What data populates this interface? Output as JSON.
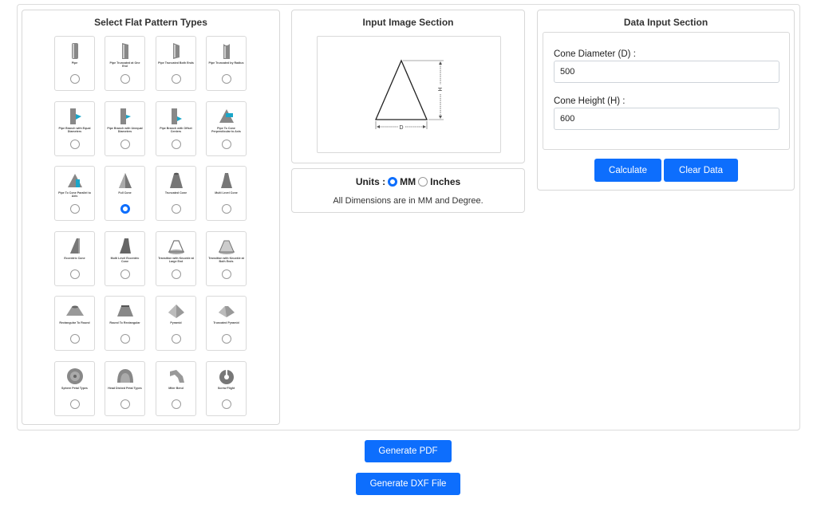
{
  "types_panel": {
    "title": "Select Flat Pattern Types",
    "items": [
      {
        "label": "Pipe",
        "icon": "pipe-icon",
        "selected": false
      },
      {
        "label": "Pipe Truncated at One End",
        "icon": "pipe-truncated-icon",
        "selected": false
      },
      {
        "label": "Pipe Truncated Both Ends",
        "icon": "pipe-truncated-both-icon",
        "selected": false
      },
      {
        "label": "Pipe Truncated by Radius",
        "icon": "pipe-radius-icon",
        "selected": false
      },
      {
        "label": "Pipe Branch with Equal Diameters",
        "icon": "pipe-branch-equal-icon",
        "selected": false
      },
      {
        "label": "Pipe Branch with Unequal Diameters",
        "icon": "pipe-branch-unequal-icon",
        "selected": false
      },
      {
        "label": "Pipe Branch with Offset Centers",
        "icon": "pipe-branch-offset-icon",
        "selected": false
      },
      {
        "label": "Pipe To Cone Perpendicular to Axis",
        "icon": "pipe-to-cone-perp-icon",
        "selected": false
      },
      {
        "label": "Pipe To Cone Parallel to Axis",
        "icon": "pipe-to-cone-parallel-icon",
        "selected": false
      },
      {
        "label": "Full Cone",
        "icon": "full-cone-icon",
        "selected": true
      },
      {
        "label": "Truncated Cone",
        "icon": "truncated-cone-icon",
        "selected": false
      },
      {
        "label": "Multi Level Cone",
        "icon": "multi-level-cone-icon",
        "selected": false
      },
      {
        "label": "Eccentric Cone",
        "icon": "eccentric-cone-icon",
        "selected": false
      },
      {
        "label": "Multi Level Eccentric Cone",
        "icon": "multi-level-eccentric-cone-icon",
        "selected": false
      },
      {
        "label": "Transition with Knuckle at Large End",
        "icon": "transition-knuckle-large-icon",
        "selected": false
      },
      {
        "label": "Transition with Knuckle at Both Ends",
        "icon": "transition-knuckle-both-icon",
        "selected": false
      },
      {
        "label": "Rectangular To Round",
        "icon": "rect-to-round-icon",
        "selected": false
      },
      {
        "label": "Round To Rectangular",
        "icon": "round-to-rect-icon",
        "selected": false
      },
      {
        "label": "Pyramid",
        "icon": "pyramid-icon",
        "selected": false
      },
      {
        "label": "Truncated Pyramid",
        "icon": "truncated-pyramid-icon",
        "selected": false
      },
      {
        "label": "Sphere Petal Types",
        "icon": "sphere-icon",
        "selected": false
      },
      {
        "label": "Head Dished Petal Types",
        "icon": "dished-head-icon",
        "selected": false
      },
      {
        "label": "Miter Bend",
        "icon": "miter-bend-icon",
        "selected": false
      },
      {
        "label": "Screw Flight",
        "icon": "screw-flight-icon",
        "selected": false
      }
    ]
  },
  "image_panel": {
    "title": "Input Image Section",
    "dim_d": "D",
    "dim_h": "H"
  },
  "units_panel": {
    "label": "Units :",
    "mm": "MM",
    "inches": "Inches",
    "selected": "MM",
    "note": "All Dimensions are in MM and Degree."
  },
  "data_panel": {
    "title": "Data Input Section",
    "diameter_label": "Cone Diameter (D) :",
    "diameter_value": "500",
    "height_label": "Cone Height (H) :",
    "height_value": "600",
    "calculate": "Calculate",
    "clear": "Clear Data"
  },
  "actions": {
    "pdf": "Generate PDF",
    "dxf": "Generate DXF File"
  },
  "colors": {
    "accent": "#0d6efd",
    "border": "#d8d8d8"
  }
}
